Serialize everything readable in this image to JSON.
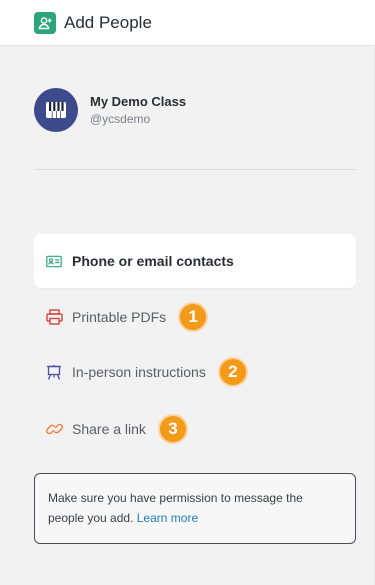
{
  "header": {
    "title": "Add People",
    "icon": "add-person-icon",
    "icon_color": "#2ca57b"
  },
  "class": {
    "name": "My Demo Class",
    "handle": "@ycsdemo",
    "avatar_icon": "piano-keys-icon",
    "avatar_color": "#3d4a8c"
  },
  "options": [
    {
      "label": "Phone or email contacts",
      "icon": "contact-card-icon",
      "icon_color": "#2ca57b",
      "active": true
    },
    {
      "label": "Printable PDFs",
      "icon": "printer-icon",
      "icon_color": "#d9453b",
      "badge": "1"
    },
    {
      "label": "In-person instructions",
      "icon": "easel-icon",
      "icon_color": "#4a4fa8",
      "badge": "2"
    },
    {
      "label": "Share a link",
      "icon": "link-icon",
      "icon_color": "#f07a3a",
      "badge": "3"
    }
  ],
  "badge_color": "#f49a1a",
  "notice": {
    "text": "Make sure you have permission to message the people you add.",
    "link": "Learn more",
    "link_color": "#1f7bbf"
  }
}
